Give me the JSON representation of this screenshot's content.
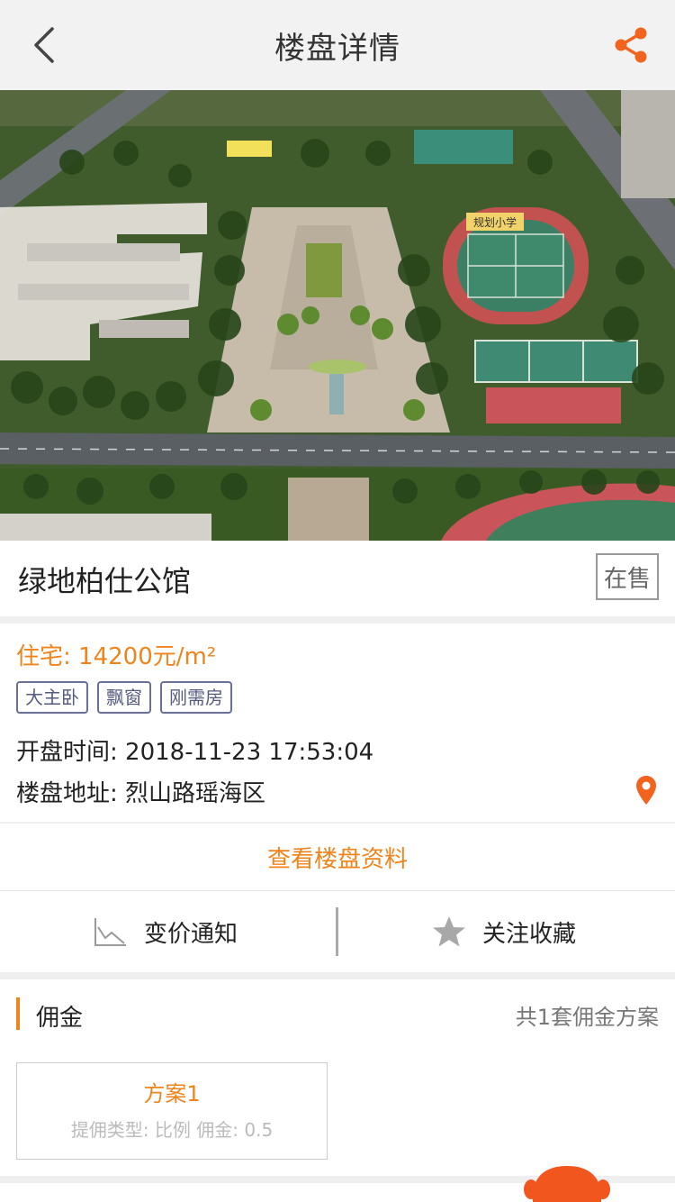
{
  "header": {
    "title": "楼盘详情"
  },
  "banner": {
    "sign_text": "规划小学"
  },
  "property": {
    "name": "绿地柏仕公馆",
    "status": "在售",
    "price_label": "住宅: 14200元/m²",
    "tags": [
      "大主卧",
      "飘窗",
      "刚需房"
    ],
    "open_time_label": "开盘时间:",
    "open_time": "2018-11-23 17:53:04",
    "address_label": "楼盘地址:",
    "address": "烈山路瑶海区"
  },
  "view_info_label": "查看楼盘资料",
  "actions": {
    "price_notice": "变价通知",
    "favorite": "关注收藏"
  },
  "commission": {
    "label": "佣金",
    "count_text": "共1套佣金方案",
    "plans": [
      {
        "name": "方案1",
        "desc": "提佣类型: 比例   佣金: 0.5"
      }
    ]
  },
  "colors": {
    "accent": "#f0841c",
    "tag_border": "#6a6f97"
  }
}
